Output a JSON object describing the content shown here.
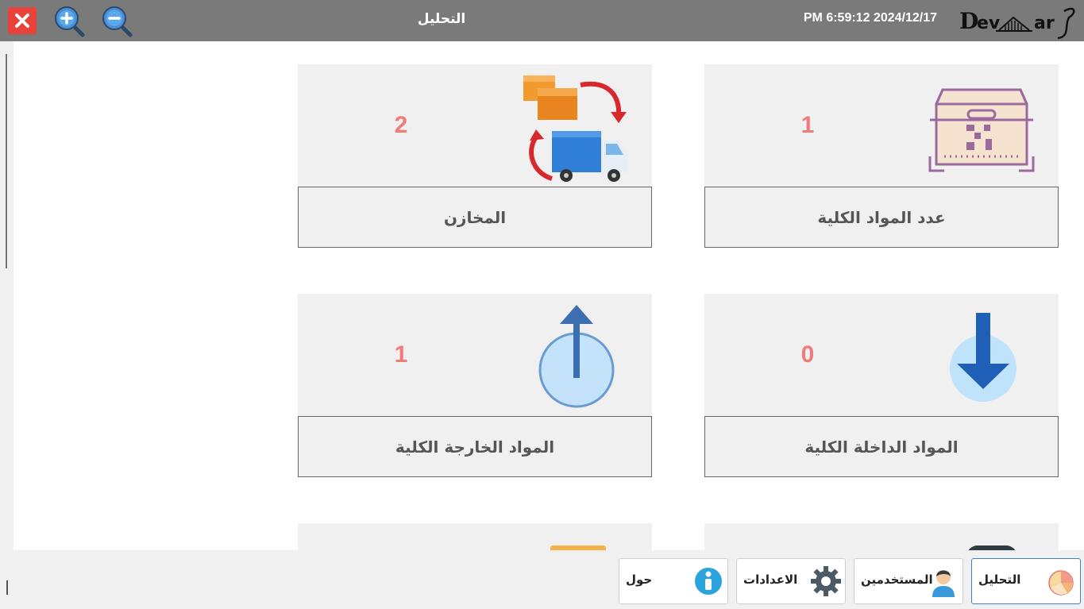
{
  "topbar": {
    "title": "التحليل",
    "datetime": "PM 6:59:12 2024/12/17",
    "logo_text": "Devmarf",
    "close_icon": "close-icon",
    "zoom_in_icon": "zoom-in-icon",
    "zoom_out_icon": "zoom-out-icon"
  },
  "cards": [
    {
      "label": "عدد المواد الكلية",
      "value": "1",
      "icon": "package-box-icon"
    },
    {
      "label": "المخازن",
      "value": "2",
      "icon": "warehouse-transfer-icon"
    },
    {
      "label": "المواد الداخلة الكلية",
      "value": "0",
      "icon": "arrow-down-icon"
    },
    {
      "label": "المواد الخارجة الكلية",
      "value": "1",
      "icon": "arrow-up-icon"
    }
  ],
  "nav": [
    {
      "label": "التحليل",
      "icon": "pie-chart-icon",
      "active": true
    },
    {
      "label": "المستخدمين",
      "icon": "user-icon",
      "active": false
    },
    {
      "label": "الاعدادات",
      "icon": "gear-icon",
      "active": false
    },
    {
      "label": "حول",
      "icon": "info-icon",
      "active": false
    }
  ],
  "colors": {
    "topbar": "#7a7a7a",
    "value": "#ef7b7b",
    "close": "#e8423a",
    "active_border": "#3b82c4"
  }
}
